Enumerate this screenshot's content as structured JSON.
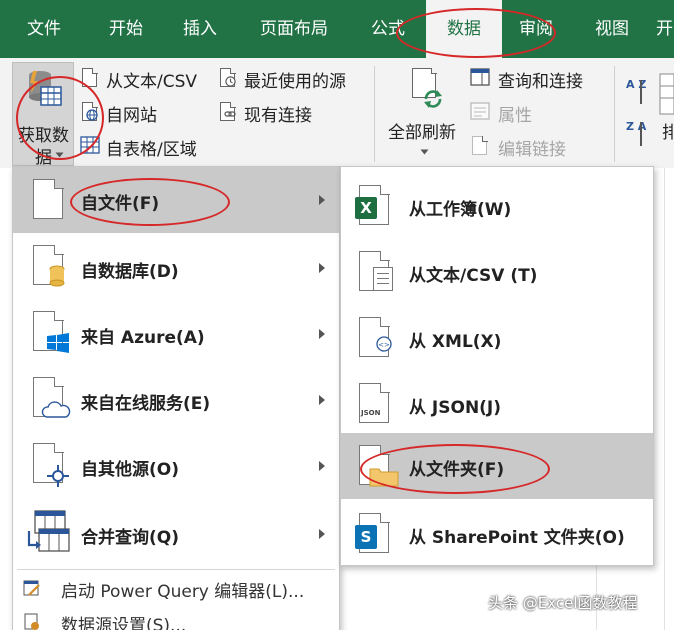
{
  "tabs": [
    "文件",
    "开始",
    "插入",
    "页面布局",
    "公式",
    "数据",
    "审阅",
    "视图",
    "开"
  ],
  "ribbon": {
    "get_data_line1": "获取数",
    "get_data_line2": "据",
    "from_text_csv": "从文本/CSV",
    "from_web": "自网站",
    "from_table": "自表格/区域",
    "recent_sources": "最近使用的源",
    "existing_connections": "现有连接",
    "refresh_all": "全部刷新",
    "queries_connections": "查询和连接",
    "properties": "属性",
    "edit_links": "编辑链接",
    "sort_partial": "排"
  },
  "main_menu": {
    "items": [
      {
        "label": "自文件(F)"
      },
      {
        "label": "自数据库(D)"
      },
      {
        "label": "来自 Azure(A)"
      },
      {
        "label": "来自在线服务(E)"
      },
      {
        "label": "自其他源(O)"
      },
      {
        "label": "合并查询(Q)"
      }
    ],
    "launch_pq": "启动 Power Query 编辑器(L)...",
    "datasource_settings": "数据源设置(S)..."
  },
  "submenu": {
    "items": [
      {
        "label": "从工作簿(W)"
      },
      {
        "label": "从文本/CSV (T)"
      },
      {
        "label": "从 XML(X)"
      },
      {
        "label": "从 JSON(J)"
      },
      {
        "label": "从文件夹(F)"
      },
      {
        "label": "从 SharePoint 文件夹(O)"
      }
    ]
  },
  "icon_text": {
    "json": "JSON",
    "az": "A Z",
    "za": "Z A"
  },
  "watermark": "头条 @Excel函数教程",
  "colors": {
    "excel_green": "#217346",
    "highlight": "#c9c9c9",
    "annotation_red": "#d62828"
  }
}
